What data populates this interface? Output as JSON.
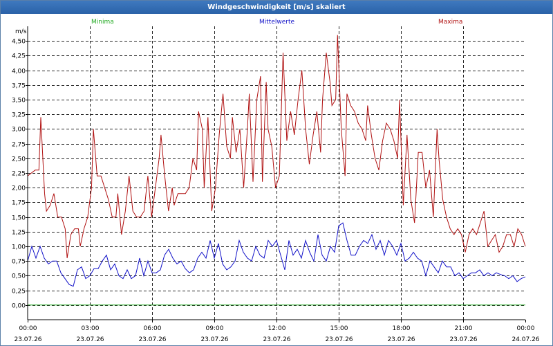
{
  "window": {
    "title": "Windgeschwindigkeit [m/s] skaliert"
  },
  "chart_data": {
    "type": "line",
    "title": "Windgeschwindigkeit [m/s] skaliert",
    "ylabel": "m/s",
    "ylim": [
      -0.25,
      4.75
    ],
    "grid": true,
    "legend_placement": "top",
    "y_ticks": [
      "4,50",
      "4,25",
      "4,00",
      "3,75",
      "3,50",
      "3,25",
      "3,00",
      "2,75",
      "2,50",
      "2,25",
      "2,00",
      "1,75",
      "1,50",
      "1,25",
      "1,00",
      "0,75",
      "0,50",
      "0,25",
      "0,00"
    ],
    "x_ticks": [
      {
        "time": "00:00",
        "date": "23.07.26"
      },
      {
        "time": "03:00",
        "date": "23.07.26"
      },
      {
        "time": "06:00",
        "date": "23.07.26"
      },
      {
        "time": "09:00",
        "date": "23.07.26"
      },
      {
        "time": "12:00",
        "date": "23.07.26"
      },
      {
        "time": "15:00",
        "date": "23.07.26"
      },
      {
        "time": "18:00",
        "date": "23.07.26"
      },
      {
        "time": "21:00",
        "date": "23.07.26"
      },
      {
        "time": "00:00",
        "date": "24.07.26"
      }
    ],
    "x_hours": [
      0,
      3,
      6,
      9,
      12,
      15,
      18,
      21,
      24
    ],
    "series": [
      {
        "name": "Minima",
        "color": "#22aa22",
        "points": [
          [
            0,
            0.0
          ],
          [
            24,
            0.0
          ]
        ]
      },
      {
        "name": "Mittelwerte",
        "color": "#1010c8",
        "points": [
          [
            0.0,
            0.75
          ],
          [
            0.2,
            1.0
          ],
          [
            0.4,
            0.8
          ],
          [
            0.6,
            1.0
          ],
          [
            0.8,
            0.8
          ],
          [
            1.0,
            0.7
          ],
          [
            1.2,
            0.75
          ],
          [
            1.4,
            0.75
          ],
          [
            1.6,
            0.55
          ],
          [
            1.8,
            0.45
          ],
          [
            2.0,
            0.35
          ],
          [
            2.2,
            0.32
          ],
          [
            2.4,
            0.6
          ],
          [
            2.6,
            0.65
          ],
          [
            2.8,
            0.45
          ],
          [
            3.0,
            0.5
          ],
          [
            3.2,
            0.62
          ],
          [
            3.4,
            0.62
          ],
          [
            3.6,
            0.75
          ],
          [
            3.8,
            0.85
          ],
          [
            4.0,
            0.6
          ],
          [
            4.2,
            0.7
          ],
          [
            4.4,
            0.5
          ],
          [
            4.6,
            0.45
          ],
          [
            4.8,
            0.6
          ],
          [
            5.0,
            0.45
          ],
          [
            5.2,
            0.5
          ],
          [
            5.4,
            0.8
          ],
          [
            5.6,
            0.5
          ],
          [
            5.8,
            0.75
          ],
          [
            6.0,
            0.55
          ],
          [
            6.2,
            0.55
          ],
          [
            6.4,
            0.6
          ],
          [
            6.6,
            0.85
          ],
          [
            6.8,
            0.95
          ],
          [
            7.0,
            0.8
          ],
          [
            7.2,
            0.7
          ],
          [
            7.4,
            0.75
          ],
          [
            7.6,
            0.62
          ],
          [
            7.8,
            0.55
          ],
          [
            8.0,
            0.6
          ],
          [
            8.2,
            0.8
          ],
          [
            8.4,
            0.9
          ],
          [
            8.6,
            0.8
          ],
          [
            8.8,
            1.1
          ],
          [
            9.0,
            0.8
          ],
          [
            9.2,
            1.05
          ],
          [
            9.4,
            0.7
          ],
          [
            9.6,
            0.6
          ],
          [
            9.8,
            0.65
          ],
          [
            10.0,
            0.75
          ],
          [
            10.2,
            1.1
          ],
          [
            10.4,
            0.9
          ],
          [
            10.6,
            0.8
          ],
          [
            10.8,
            0.75
          ],
          [
            11.0,
            1.0
          ],
          [
            11.2,
            0.85
          ],
          [
            11.4,
            0.8
          ],
          [
            11.6,
            1.1
          ],
          [
            11.8,
            1.0
          ],
          [
            12.0,
            1.1
          ],
          [
            12.2,
            0.85
          ],
          [
            12.4,
            0.6
          ],
          [
            12.6,
            1.1
          ],
          [
            12.8,
            0.85
          ],
          [
            13.0,
            0.95
          ],
          [
            13.2,
            0.8
          ],
          [
            13.4,
            1.1
          ],
          [
            13.6,
            0.9
          ],
          [
            13.8,
            0.75
          ],
          [
            14.0,
            1.2
          ],
          [
            14.2,
            0.85
          ],
          [
            14.4,
            0.75
          ],
          [
            14.6,
            1.0
          ],
          [
            14.8,
            0.9
          ],
          [
            15.0,
            1.35
          ],
          [
            15.2,
            1.4
          ],
          [
            15.4,
            1.1
          ],
          [
            15.6,
            0.85
          ],
          [
            15.8,
            0.85
          ],
          [
            16.0,
            1.0
          ],
          [
            16.2,
            1.1
          ],
          [
            16.4,
            1.05
          ],
          [
            16.6,
            1.2
          ],
          [
            16.8,
            0.95
          ],
          [
            17.0,
            1.1
          ],
          [
            17.2,
            0.85
          ],
          [
            17.4,
            1.1
          ],
          [
            17.6,
            1.0
          ],
          [
            17.8,
            0.85
          ],
          [
            18.0,
            1.05
          ],
          [
            18.2,
            0.75
          ],
          [
            18.4,
            0.8
          ],
          [
            18.6,
            0.9
          ],
          [
            18.8,
            0.8
          ],
          [
            19.0,
            0.75
          ],
          [
            19.2,
            0.5
          ],
          [
            19.4,
            0.75
          ],
          [
            19.6,
            0.65
          ],
          [
            19.8,
            0.55
          ],
          [
            20.0,
            0.75
          ],
          [
            20.2,
            0.65
          ],
          [
            20.4,
            0.65
          ],
          [
            20.6,
            0.5
          ],
          [
            20.8,
            0.55
          ],
          [
            21.0,
            0.45
          ],
          [
            21.2,
            0.5
          ],
          [
            21.4,
            0.55
          ],
          [
            21.6,
            0.55
          ],
          [
            21.8,
            0.6
          ],
          [
            22.0,
            0.5
          ],
          [
            22.2,
            0.55
          ],
          [
            22.4,
            0.5
          ],
          [
            22.6,
            0.55
          ],
          [
            22.8,
            0.52
          ],
          [
            23.0,
            0.5
          ],
          [
            23.2,
            0.45
          ],
          [
            23.4,
            0.5
          ],
          [
            23.6,
            0.4
          ],
          [
            23.8,
            0.45
          ],
          [
            24.0,
            0.48
          ]
        ]
      },
      {
        "name": "Maxima",
        "color": "#b01010",
        "points": [
          [
            0.0,
            2.2
          ],
          [
            0.2,
            2.25
          ],
          [
            0.4,
            2.3
          ],
          [
            0.6,
            2.3
          ],
          [
            0.7,
            3.2
          ],
          [
            0.9,
            1.9
          ],
          [
            1.0,
            1.6
          ],
          [
            1.2,
            1.7
          ],
          [
            1.4,
            1.9
          ],
          [
            1.6,
            1.5
          ],
          [
            1.8,
            1.5
          ],
          [
            2.0,
            1.3
          ],
          [
            2.1,
            0.8
          ],
          [
            2.3,
            1.2
          ],
          [
            2.5,
            1.3
          ],
          [
            2.7,
            1.3
          ],
          [
            2.8,
            1.0
          ],
          [
            3.0,
            1.3
          ],
          [
            3.2,
            1.5
          ],
          [
            3.4,
            2.0
          ],
          [
            3.5,
            3.0
          ],
          [
            3.7,
            2.2
          ],
          [
            3.9,
            2.2
          ],
          [
            4.1,
            2.0
          ],
          [
            4.3,
            1.8
          ],
          [
            4.5,
            1.5
          ],
          [
            4.7,
            1.5
          ],
          [
            4.8,
            1.9
          ],
          [
            5.0,
            1.2
          ],
          [
            5.2,
            1.6
          ],
          [
            5.4,
            2.2
          ],
          [
            5.6,
            1.6
          ],
          [
            5.8,
            1.5
          ],
          [
            6.0,
            1.5
          ],
          [
            6.2,
            1.6
          ],
          [
            6.4,
            2.2
          ],
          [
            6.6,
            1.5
          ],
          [
            6.8,
            2.0
          ],
          [
            7.0,
            2.5
          ],
          [
            7.1,
            2.9
          ],
          [
            7.3,
            2.2
          ],
          [
            7.5,
            1.6
          ],
          [
            7.7,
            2.0
          ],
          [
            7.8,
            1.7
          ],
          [
            8.0,
            1.9
          ],
          [
            8.2,
            1.9
          ],
          [
            8.4,
            1.9
          ],
          [
            8.6,
            2.0
          ],
          [
            8.8,
            2.5
          ],
          [
            9.0,
            2.3
          ],
          [
            9.1,
            3.3
          ],
          [
            9.3,
            3.0
          ],
          [
            9.4,
            2.0
          ],
          [
            9.6,
            3.2
          ],
          [
            9.8,
            1.6
          ],
          [
            10.0,
            2.0
          ],
          [
            10.2,
            2.9
          ],
          [
            10.4,
            3.6
          ],
          [
            10.6,
            2.7
          ],
          [
            10.8,
            2.5
          ],
          [
            10.9,
            3.2
          ],
          [
            11.1,
            2.6
          ],
          [
            11.3,
            3.0
          ],
          [
            11.5,
            2.0
          ],
          [
            11.7,
            3.0
          ],
          [
            11.8,
            3.6
          ],
          [
            12.0,
            2.1
          ],
          [
            12.2,
            3.5
          ],
          [
            12.4,
            3.9
          ],
          [
            12.5,
            2.1
          ],
          [
            12.7,
            3.8
          ],
          [
            12.8,
            3.0
          ],
          [
            13.0,
            2.7
          ],
          [
            13.2,
            2.0
          ],
          [
            13.4,
            2.2
          ],
          [
            13.6,
            4.3
          ],
          [
            13.8,
            2.8
          ],
          [
            14.0,
            3.3
          ],
          [
            14.2,
            2.9
          ],
          [
            14.4,
            3.5
          ],
          [
            14.6,
            4.0
          ],
          [
            14.8,
            3.0
          ],
          [
            15.0,
            2.4
          ],
          [
            15.2,
            2.9
          ],
          [
            15.4,
            3.3
          ],
          [
            15.6,
            2.6
          ],
          [
            15.7,
            3.5
          ],
          [
            15.9,
            4.3
          ],
          [
            16.1,
            3.8
          ],
          [
            16.2,
            3.4
          ],
          [
            16.4,
            3.5
          ],
          [
            16.5,
            4.6
          ],
          [
            16.7,
            3.0
          ],
          [
            16.9,
            2.2
          ],
          [
            17.0,
            3.6
          ],
          [
            17.2,
            3.4
          ],
          [
            17.4,
            3.3
          ],
          [
            17.6,
            3.1
          ],
          [
            17.8,
            3.0
          ],
          [
            18.0,
            2.8
          ],
          [
            18.1,
            3.4
          ],
          [
            18.3,
            2.9
          ],
          [
            18.5,
            2.5
          ],
          [
            18.7,
            2.3
          ],
          [
            18.9,
            2.8
          ],
          [
            19.1,
            3.1
          ],
          [
            19.3,
            3.0
          ],
          [
            19.5,
            2.8
          ],
          [
            19.7,
            2.5
          ],
          [
            19.8,
            3.5
          ],
          [
            20.0,
            1.7
          ],
          [
            20.2,
            2.9
          ],
          [
            20.4,
            1.8
          ],
          [
            20.6,
            1.4
          ],
          [
            20.8,
            2.6
          ],
          [
            21.0,
            2.6
          ],
          [
            21.2,
            2.0
          ],
          [
            21.4,
            2.3
          ],
          [
            21.6,
            1.5
          ],
          [
            21.8,
            3.0
          ],
          [
            21.9,
            2.5
          ],
          [
            22.1,
            1.8
          ],
          [
            22.3,
            1.5
          ],
          [
            22.5,
            1.3
          ],
          [
            22.7,
            1.2
          ],
          [
            22.9,
            1.3
          ],
          [
            23.1,
            1.2
          ],
          [
            23.3,
            0.9
          ],
          [
            23.5,
            1.2
          ],
          [
            23.7,
            1.3
          ],
          [
            23.9,
            1.2
          ],
          [
            24.1,
            1.4
          ],
          [
            24.3,
            1.6
          ],
          [
            24.5,
            1.0
          ],
          [
            24.7,
            1.1
          ],
          [
            24.9,
            1.2
          ],
          [
            25.1,
            0.9
          ],
          [
            25.3,
            1.0
          ],
          [
            25.5,
            1.2
          ],
          [
            25.7,
            1.2
          ],
          [
            25.9,
            1.0
          ],
          [
            26.1,
            1.3
          ],
          [
            26.3,
            1.2
          ],
          [
            26.5,
            1.0
          ]
        ]
      }
    ]
  }
}
